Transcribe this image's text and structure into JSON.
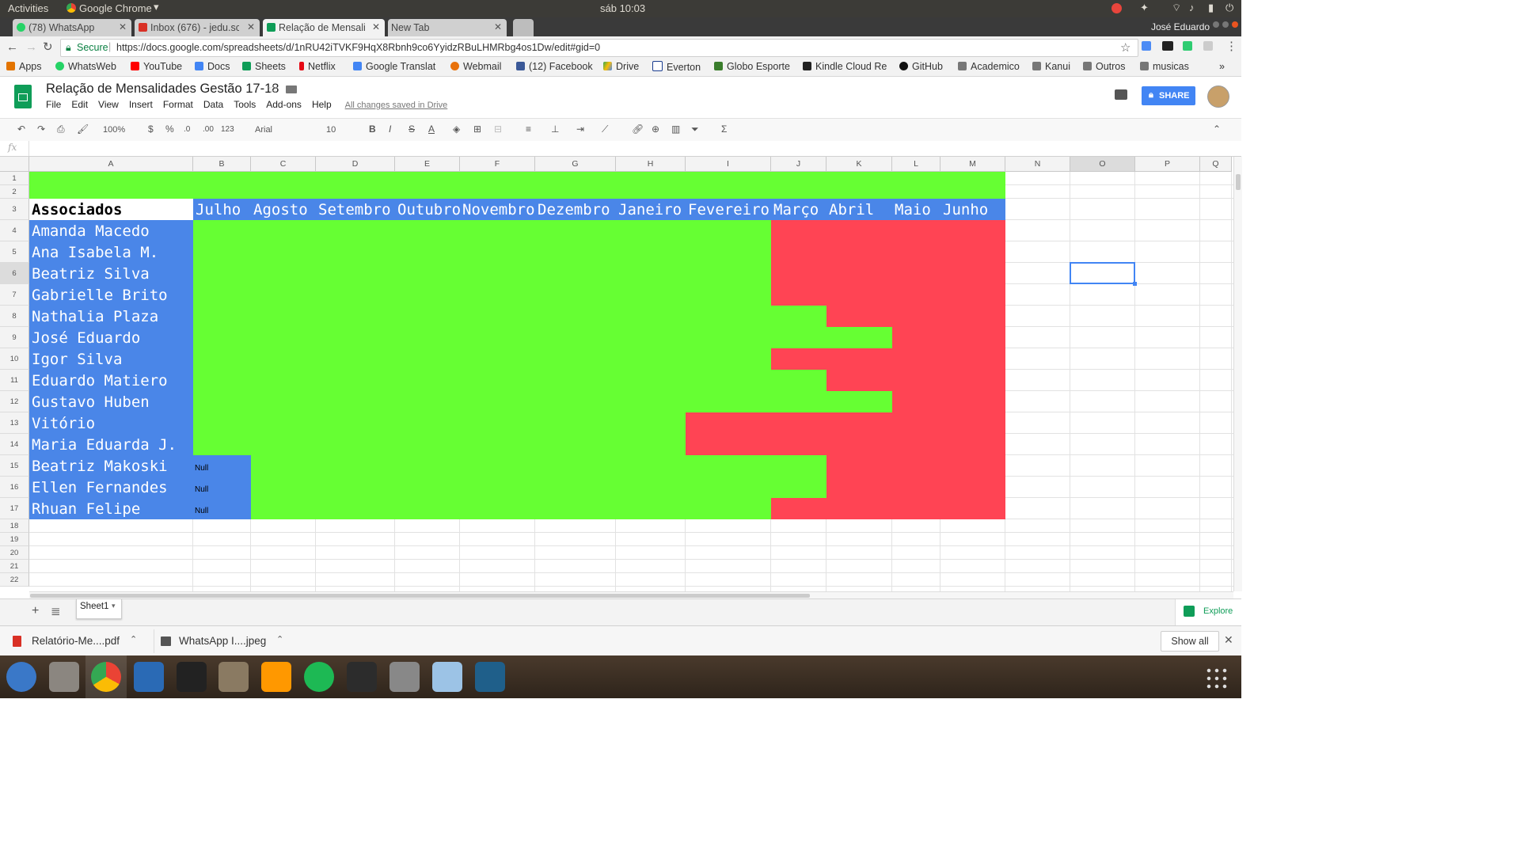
{
  "system": {
    "activities": "Activities",
    "app": "Google Chrome",
    "clock": "sáb 10:03"
  },
  "browser": {
    "tabs": [
      {
        "label": "(78) WhatsApp",
        "color": "#25d366"
      },
      {
        "label": "Inbox (676) - jedu.sc",
        "color": "#d93025"
      },
      {
        "label": "Relação de Mensalic",
        "color": "#0f9d58"
      },
      {
        "label": "New Tab",
        "color": "#cccccc"
      }
    ],
    "profile": "José Eduardo",
    "secure_label": "Secure",
    "url": "https://docs.google.com/spreadsheets/d/1nRU42iTVKF9HqX8Rbnh9co6YyidzRBuLHMRbg4os1Dw/edit#gid=0",
    "bookmarks": [
      {
        "label": "Apps",
        "color": "#e37400"
      },
      {
        "label": "WhatsWeb",
        "color": "#25d366"
      },
      {
        "label": "YouTube",
        "color": "#ff0000"
      },
      {
        "label": "Docs",
        "color": "#4285f4"
      },
      {
        "label": "Sheets",
        "color": "#0f9d58"
      },
      {
        "label": "Netflix",
        "color": "#e50914"
      },
      {
        "label": "Google Translat",
        "color": "#4285f4"
      },
      {
        "label": "Webmail",
        "color": "#e8710a"
      },
      {
        "label": "(12) Facebook",
        "color": "#3b5998"
      },
      {
        "label": "Drive",
        "color": "#fbbc04"
      },
      {
        "label": "Everton",
        "color": "#1a3d8f"
      },
      {
        "label": "Globo Esporte",
        "color": "#3a7d2c"
      },
      {
        "label": "Kindle Cloud Re",
        "color": "#222222"
      },
      {
        "label": "GitHub",
        "color": "#111111"
      },
      {
        "label": "Academico",
        "color": "#777777"
      },
      {
        "label": "Kanui",
        "color": "#777777"
      },
      {
        "label": "Outros",
        "color": "#777777"
      },
      {
        "label": "musicas",
        "color": "#777777"
      }
    ],
    "bookmarks_more": "»"
  },
  "sheets": {
    "title": "Relação de Mensalidades Gestão 17-18",
    "menu": [
      "File",
      "Edit",
      "View",
      "Insert",
      "Format",
      "Data",
      "Tools",
      "Add-ons",
      "Help"
    ],
    "saved_status": "All changes saved in Drive",
    "share_label": "SHARE",
    "toolbar": {
      "zoom": "100%",
      "currency": "$",
      "percent": "%",
      "dec_less": ".0",
      "dec_more": ".00",
      "format_more": "123",
      "font": "Arial",
      "size": "10",
      "bold": "B",
      "italic": "I",
      "strike": "S",
      "text_color": "A",
      "sum": "Σ"
    },
    "fx_label": "fx",
    "columns": [
      "A",
      "B",
      "C",
      "D",
      "E",
      "F",
      "G",
      "H",
      "I",
      "J",
      "K",
      "L",
      "M",
      "N",
      "O",
      "P",
      "Q"
    ],
    "rows": [
      1,
      2,
      3,
      4,
      5,
      6,
      7,
      8,
      9,
      10,
      11,
      12,
      13,
      14,
      15,
      16,
      17,
      18,
      19,
      20,
      21,
      22
    ],
    "header_label": "Associados",
    "months": [
      "Julho",
      "Agosto",
      "Setembro",
      "Outubro",
      "Novembro",
      "Dezembro",
      "Janeiro",
      "Fevereiro",
      "Março",
      "Abril",
      "Maio",
      "Junho"
    ],
    "members": [
      {
        "name": "Amanda Macedo",
        "status": [
          "G",
          "G",
          "G",
          "G",
          "G",
          "G",
          "G",
          "G",
          "R",
          "R",
          "R",
          "R"
        ]
      },
      {
        "name": "Ana Isabela M.",
        "status": [
          "G",
          "G",
          "G",
          "G",
          "G",
          "G",
          "G",
          "G",
          "R",
          "R",
          "R",
          "R"
        ]
      },
      {
        "name": "Beatriz Silva",
        "status": [
          "G",
          "G",
          "G",
          "G",
          "G",
          "G",
          "G",
          "G",
          "R",
          "R",
          "R",
          "R"
        ]
      },
      {
        "name": "Gabrielle Brito",
        "status": [
          "G",
          "G",
          "G",
          "G",
          "G",
          "G",
          "G",
          "G",
          "R",
          "R",
          "R",
          "R"
        ]
      },
      {
        "name": "Nathalia Plaza",
        "status": [
          "G",
          "G",
          "G",
          "G",
          "G",
          "G",
          "G",
          "G",
          "G",
          "R",
          "R",
          "R"
        ]
      },
      {
        "name": "José Eduardo",
        "status": [
          "G",
          "G",
          "G",
          "G",
          "G",
          "G",
          "G",
          "G",
          "G",
          "G",
          "R",
          "R"
        ]
      },
      {
        "name": "Igor Silva",
        "status": [
          "G",
          "G",
          "G",
          "G",
          "G",
          "G",
          "G",
          "G",
          "R",
          "R",
          "R",
          "R"
        ]
      },
      {
        "name": "Eduardo Matiero",
        "status": [
          "G",
          "G",
          "G",
          "G",
          "G",
          "G",
          "G",
          "G",
          "G",
          "R",
          "R",
          "R"
        ]
      },
      {
        "name": "Gustavo Huben",
        "status": [
          "G",
          "G",
          "G",
          "G",
          "G",
          "G",
          "G",
          "G",
          "G",
          "G",
          "R",
          "R"
        ]
      },
      {
        "name": "Vitório",
        "status": [
          "G",
          "G",
          "G",
          "G",
          "G",
          "G",
          "G",
          "R",
          "R",
          "R",
          "R",
          "R"
        ]
      },
      {
        "name": "Maria Eduarda J.",
        "status": [
          "G",
          "G",
          "G",
          "G",
          "G",
          "G",
          "G",
          "R",
          "R",
          "R",
          "R",
          "R"
        ]
      },
      {
        "name": "Beatriz Makoski",
        "status": [
          "N",
          "G",
          "G",
          "G",
          "G",
          "G",
          "G",
          "G",
          "G",
          "R",
          "R",
          "R"
        ]
      },
      {
        "name": "Ellen Fernandes",
        "status": [
          "N",
          "G",
          "G",
          "G",
          "G",
          "G",
          "G",
          "G",
          "G",
          "R",
          "R",
          "R"
        ]
      },
      {
        "name": "Rhuan Felipe",
        "status": [
          "N",
          "G",
          "G",
          "G",
          "G",
          "G",
          "G",
          "G",
          "R",
          "R",
          "R",
          "R"
        ]
      }
    ],
    "null_label": "Null",
    "colors": {
      "green": "#66ff33",
      "red": "#ff4454",
      "blue": "#4a86e8",
      "selection": "#4285f4",
      "share": "#4285f4"
    },
    "sheet_tab": "Sheet1",
    "explore_label": "Explore"
  },
  "downloads": {
    "items": [
      {
        "label": "Relatório-Me....pdf",
        "icon": "pdf-icon"
      },
      {
        "label": "WhatsApp I....jpeg",
        "icon": "image-icon"
      }
    ],
    "show_all": "Show all"
  },
  "dock": {
    "icons": [
      {
        "name": "thunderbird-icon",
        "color": "#3a78c8"
      },
      {
        "name": "files-icon",
        "color": "#8b8680"
      },
      {
        "name": "chrome-icon",
        "color": "#e8453c"
      },
      {
        "name": "writer-icon",
        "color": "#2a6ab5"
      },
      {
        "name": "inkscape-icon",
        "color": "#222222"
      },
      {
        "name": "gimp-icon",
        "color": "#8a7a62"
      },
      {
        "name": "sublime-icon",
        "color": "#ff9800"
      },
      {
        "name": "spotify-icon",
        "color": "#1db954"
      },
      {
        "name": "terminal-icon",
        "color": "#2c2c2c"
      },
      {
        "name": "calculator-icon",
        "color": "#888888"
      },
      {
        "name": "virtualbox-icon",
        "color": "#9cc3e6"
      },
      {
        "name": "mysql-workbench-icon",
        "color": "#1f5f8a"
      }
    ]
  }
}
